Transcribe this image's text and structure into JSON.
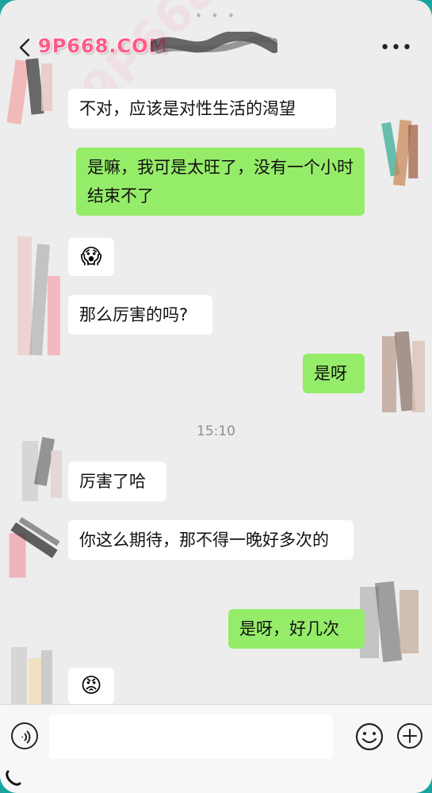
{
  "header": {
    "title": "9P668.COM",
    "more_label": "•••"
  },
  "watermark": "9P668.COM",
  "messages": [
    {
      "side": "in",
      "text": "不对，应该是对性生活的渴望"
    },
    {
      "side": "out",
      "text": "是嘛，我可是太旺了，没有一个小时结束不了"
    },
    {
      "side": "in",
      "emoji": "😱"
    },
    {
      "side": "in",
      "text": "那么厉害的吗?"
    },
    {
      "side": "out",
      "text": "是呀"
    },
    {
      "side": "time",
      "text": "15:10"
    },
    {
      "side": "in",
      "text": "厉害了哈"
    },
    {
      "side": "in",
      "text": "你这么期待，那不得一晚好多次的"
    },
    {
      "side": "out",
      "text": "是呀，好几次"
    },
    {
      "side": "in",
      "emoji": "😡"
    }
  ],
  "input": {
    "value": "",
    "placeholder": ""
  },
  "colors": {
    "incoming_bubble": "#ffffff",
    "outgoing_bubble": "#95ec69",
    "background": "#ededed",
    "title": "#ff5a87"
  }
}
